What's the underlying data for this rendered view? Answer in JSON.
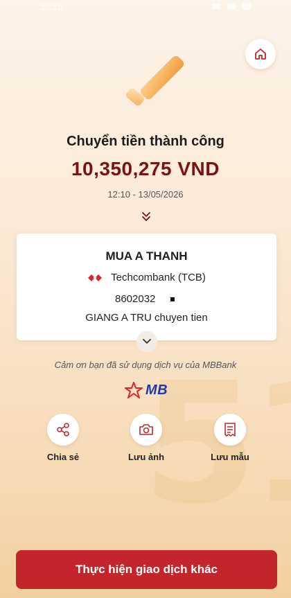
{
  "status": {
    "time": "12:10"
  },
  "result": {
    "title": "Chuyển tiền thành công",
    "amount": "10,350,275 VND",
    "datetime": "12:10 - 13/05/2026"
  },
  "recipient": {
    "name": "MUA A THANH",
    "bank": "Techcombank (TCB)",
    "account": "8602032",
    "memo": "GIANG A TRU chuyen tien"
  },
  "thanks": "Cảm ơn bạn đã sử dụng dịch vụ của MBBank",
  "brand": {
    "logo_text": "MB",
    "primary": "#c3252b",
    "amount_color": "#7a1212",
    "logo_color": "#1f3aa6"
  },
  "actions": [
    {
      "label": "Chia sẻ",
      "icon": "share-icon"
    },
    {
      "label": "Lưu ảnh",
      "icon": "camera-icon"
    },
    {
      "label": "Lưu mẫu",
      "icon": "receipt-icon"
    }
  ],
  "primary_button": "Thực hiện giao dịch khác"
}
